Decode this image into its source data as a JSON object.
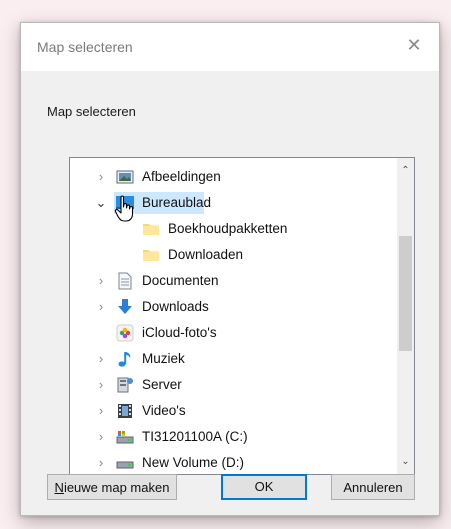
{
  "window": {
    "title": "Map selecteren",
    "close_glyph": "✕",
    "description": "Map selecteren"
  },
  "tree": {
    "items": [
      {
        "label": "Afbeeldingen",
        "icon": "pictures-icon",
        "expander": "›",
        "level": 0,
        "state": "collapsed"
      },
      {
        "label": "Bureaublad",
        "icon": "desktop-icon",
        "expander": "⌄",
        "level": 0,
        "state": "expanded",
        "selected": true
      },
      {
        "label": "Boekhoudpakketten",
        "icon": "folder-icon",
        "expander": "",
        "level": 1
      },
      {
        "label": "Downloaden",
        "icon": "folder-icon",
        "expander": "",
        "level": 1
      },
      {
        "label": "Documenten",
        "icon": "documents-icon",
        "expander": "›",
        "level": 0,
        "state": "collapsed"
      },
      {
        "label": "Downloads",
        "icon": "downloads-icon",
        "expander": "›",
        "level": 0,
        "state": "collapsed"
      },
      {
        "label": "iCloud-foto's",
        "icon": "icloud-photos-icon",
        "expander": "",
        "level": 0
      },
      {
        "label": "Muziek",
        "icon": "music-icon",
        "expander": "›",
        "level": 0,
        "state": "collapsed"
      },
      {
        "label": "Server",
        "icon": "server-icon",
        "expander": "›",
        "level": 0,
        "state": "collapsed"
      },
      {
        "label": "Video's",
        "icon": "videos-icon",
        "expander": "›",
        "level": 0,
        "state": "collapsed"
      },
      {
        "label": "TI31201100A (C:)",
        "icon": "drive-c-icon",
        "expander": "›",
        "level": 0,
        "state": "collapsed"
      },
      {
        "label": "New Volume (D:)",
        "icon": "drive-d-icon",
        "expander": "›",
        "level": 0,
        "state": "collapsed"
      }
    ],
    "scroll_up_glyph": "⌃",
    "scroll_down_glyph": "⌄"
  },
  "buttons": {
    "new_folder_mnemonic": "N",
    "new_folder_rest": "ieuwe map maken",
    "ok": "OK",
    "cancel": "Annuleren"
  },
  "colors": {
    "selection": "#cce8ff",
    "accent": "#0078d7",
    "folder": "#f8d775"
  }
}
